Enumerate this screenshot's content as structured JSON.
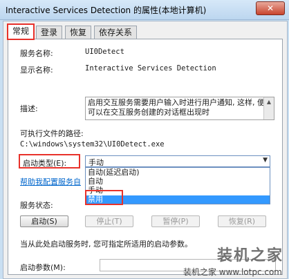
{
  "window": {
    "title": "Interactive Services Detection 的属性(本地计算机)",
    "close_symbol": "✕"
  },
  "tabs": [
    {
      "label": "常规",
      "active": true
    },
    {
      "label": "登录",
      "active": false
    },
    {
      "label": "恢复",
      "active": false
    },
    {
      "label": "依存关系",
      "active": false
    }
  ],
  "general": {
    "service_name_label": "服务名称:",
    "service_name_value": "UI0Detect",
    "display_name_label": "显示名称:",
    "display_name_value": "Interactive Services Detection",
    "description_label": "描述:",
    "description_value": "启用交互服务需要用户输入时进行用户通知, 这样, 便可以在交互服务创建的对话框出现时",
    "path_label": "可执行文件的路径:",
    "path_value": "C:\\windows\\system32\\UI0Detect.exe",
    "startup_type_label": "启动类型(E):",
    "startup_type_selected": "手动",
    "startup_type_options": [
      "自动(延迟启动)",
      "自动",
      "手动",
      "禁用"
    ],
    "startup_type_highlighted": "禁用",
    "help_link": "帮助我配置服务自",
    "service_status_label": "服务状态:",
    "buttons": {
      "start": "启动(S)",
      "stop": "停止(T)",
      "pause": "暂停(P)",
      "resume": "恢复(R)"
    },
    "start_hint": "当从此处启动服务时, 您可指定所适用的启动参数。",
    "start_params_label": "启动参数(M):",
    "start_params_value": ""
  },
  "watermark": {
    "logo_text": "装机之家",
    "site_text": "装机之家 www.lotpc.com"
  }
}
